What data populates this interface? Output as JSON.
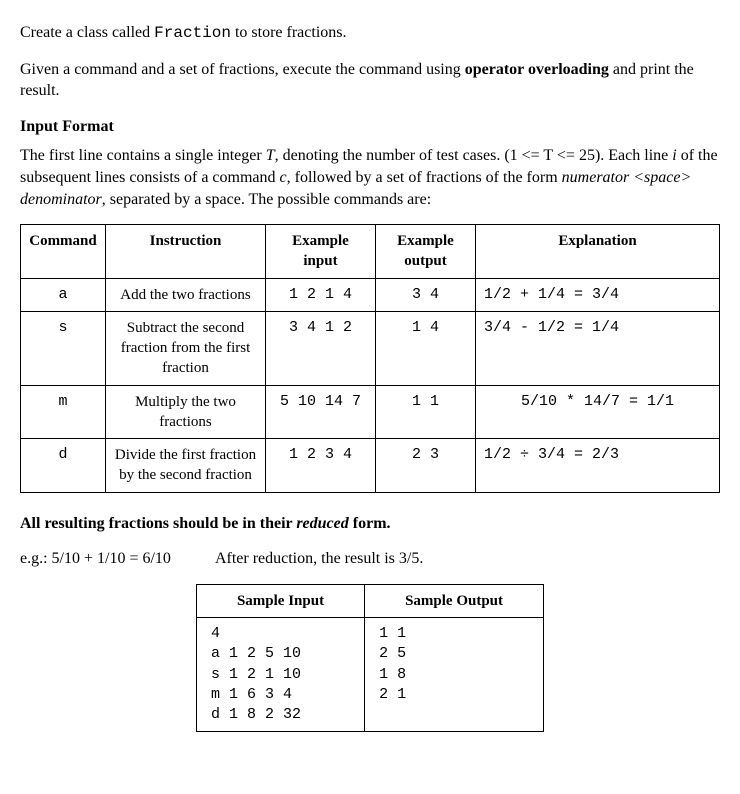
{
  "intro": {
    "sent1_pre": "Create a class called ",
    "sent1_code": "Fraction",
    "sent1_post": " to store fractions.",
    "sent2_pre": "Given a command and a set of fractions, execute the command using ",
    "sent2_bold": "operator overloading",
    "sent2_post": " and print the result."
  },
  "input_format": {
    "heading": "Input Format",
    "p1_a": "The first line contains a single integer ",
    "p1_T": "T",
    "p1_b": ", denoting the number of test cases. (1 <= T <= 25). Each line ",
    "p1_i": "i",
    "p1_c": " of the  subsequent lines consists of a command ",
    "p1_cvar": "c",
    "p1_d": ", followed by a set of fractions of the form ",
    "p1_form": "numerator <space> denominator",
    "p1_e": ", separated by a space. The possible commands are:"
  },
  "cmdtable": {
    "headers": [
      "Command",
      "Instruction",
      "Example input",
      "Example output",
      "Explanation"
    ],
    "rows": [
      {
        "cmd": "a",
        "instr": "Add the two fractions",
        "exin": "1 2 1 4",
        "exout": "3 4",
        "expl": "1/2 + 1/4 = 3/4"
      },
      {
        "cmd": "s",
        "instr": "Subtract the second fraction from the first fraction",
        "exin": "3 4 1 2",
        "exout": "1 4",
        "expl": "3/4 - 1/2 = 1/4"
      },
      {
        "cmd": "m",
        "instr": "Multiply the two fractions",
        "exin": "5 10 14 7",
        "exout": "1 1",
        "expl": "5/10 * 14/7 = 1/1"
      },
      {
        "cmd": "d",
        "instr": "Divide the first fraction by the second fraction",
        "exin": "1 2 3 4",
        "exout": "2 3",
        "expl": "1/2 ÷ 3/4 = 2/3"
      }
    ]
  },
  "reduce": {
    "line1_a": "All resulting fractions should be in their ",
    "line1_b": "reduced",
    "line1_c": " form.",
    "eg_a": "e.g.: 5/10 + 1/10 = 6/10",
    "eg_b": "After reduction, the result is 3/5."
  },
  "sample": {
    "headers": [
      "Sample Input",
      "Sample Output"
    ],
    "input": "4\na 1 2 5 10\ns 1 2 1 10\nm 1 6 3 4\nd 1 8 2 32",
    "output": "1 1\n2 5\n1 8\n2 1"
  }
}
